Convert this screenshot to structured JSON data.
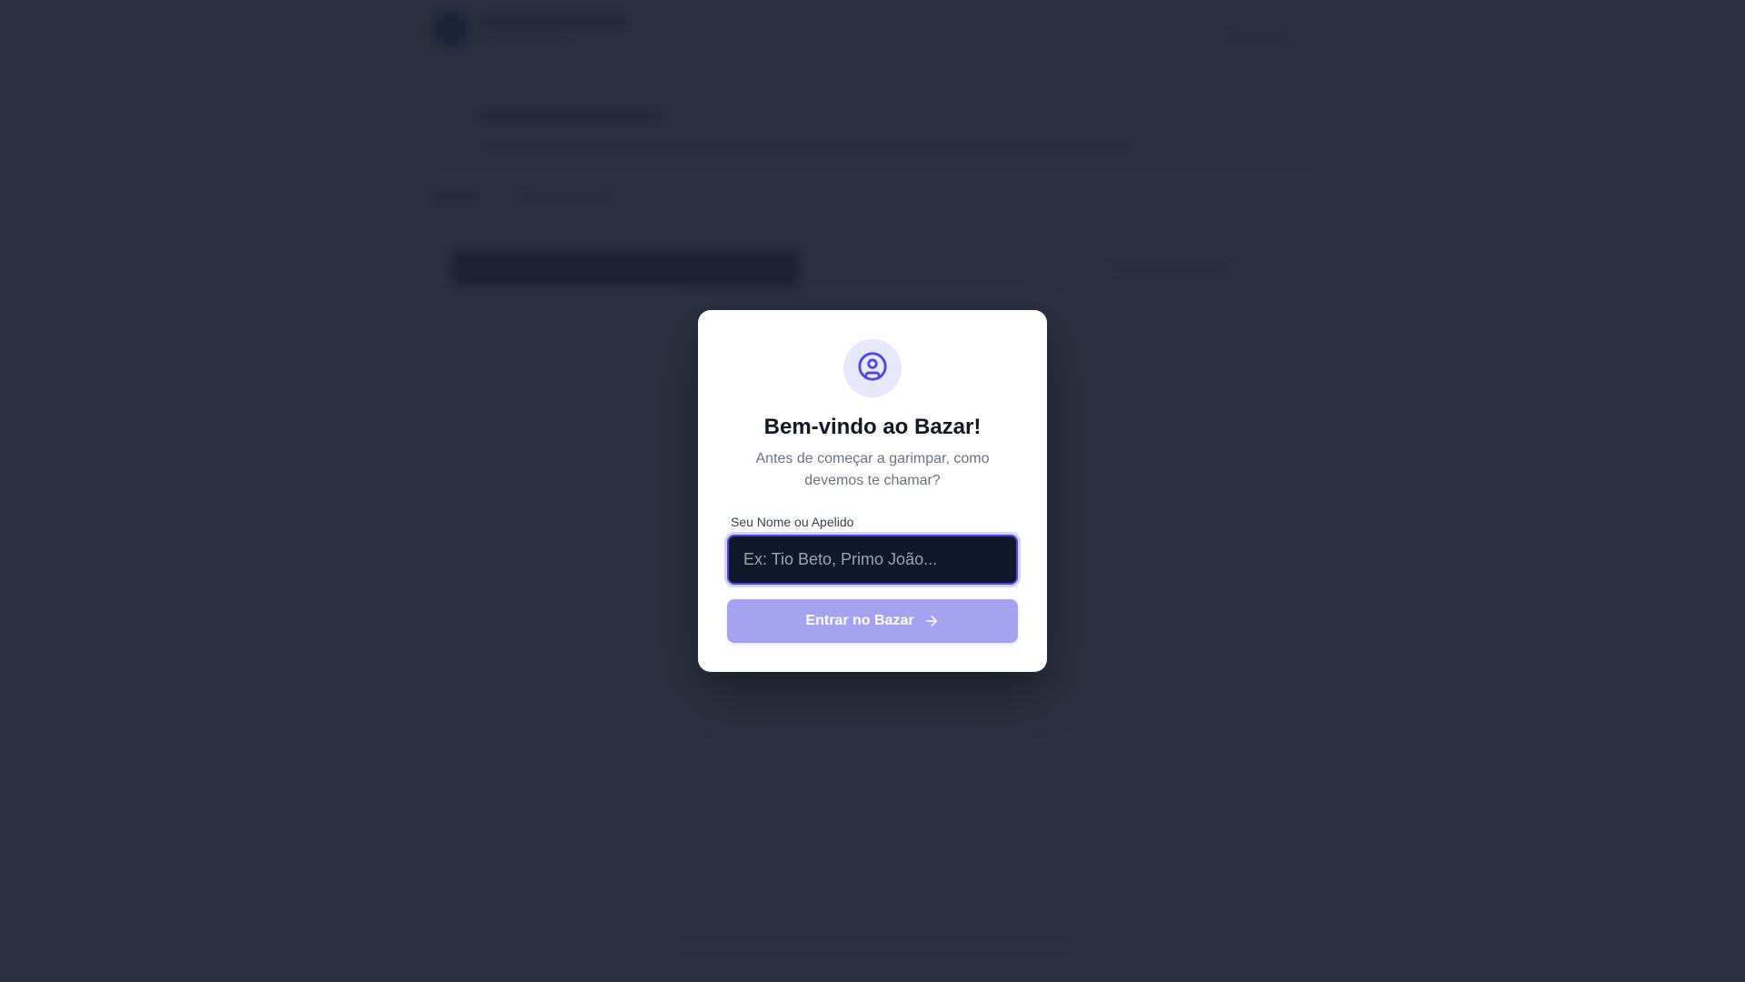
{
  "modal": {
    "icon": "user-circle-icon",
    "title": "Bem-vindo ao Bazar!",
    "subtitle": "Antes de começar a garimpar, como devemos te chamar?",
    "field_label": "Seu Nome ou Apelido",
    "input_value": "",
    "input_placeholder": "Ex: Tio Beto, Primo João...",
    "submit_label": "Entrar no Bazar",
    "submit_icon": "arrow-right-icon"
  },
  "colors": {
    "accent": "#4f46e5",
    "button_disabled": "#a5a2ef",
    "overlay": "#1e2334",
    "input_bg": "#0f172a"
  }
}
